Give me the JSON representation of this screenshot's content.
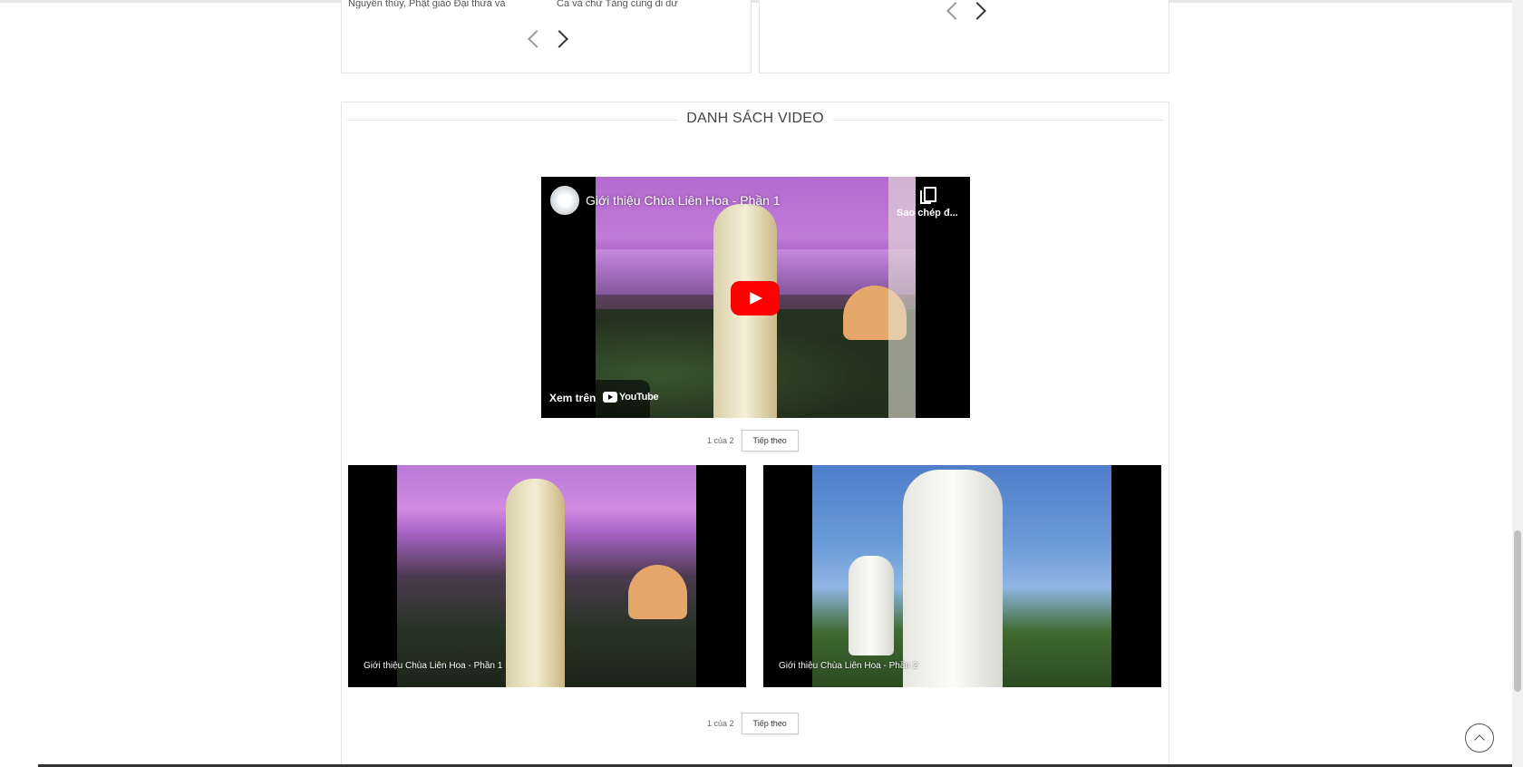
{
  "top_panels": {
    "left_text_1": "Nguyên thủy, Phật giáo Đại thừa và",
    "left_text_2": "Ca và chư Tăng cùng đi dư"
  },
  "video_section": {
    "title": "DANH SÁCH VIDEO",
    "player": {
      "title": "Giới thiệu Chùa Liên Hoa - Phần 1",
      "copy_label": "Sao chép đ...",
      "watch_on": "Xem trên",
      "youtube_logo": "YouTube"
    },
    "pager_top": {
      "label": "1 của 2",
      "next": "Tiếp theo"
    },
    "thumbnails": [
      {
        "caption": "Giới thiệu Chùa Liên Hoa - Phần 1"
      },
      {
        "caption": "Giới thiệu Chùa Liên Hoa - Phần 2"
      }
    ],
    "pager_bottom": {
      "label": "1 của 2",
      "next": "Tiếp theo"
    }
  },
  "icons": {
    "prev": "chevron-left-icon",
    "next": "chevron-right-icon",
    "copy": "copy-icon",
    "play": "play-icon",
    "back_to_top": "chevron-up-icon"
  },
  "colors": {
    "youtube_red": "#ff0000",
    "border": "#e6e6e6"
  }
}
